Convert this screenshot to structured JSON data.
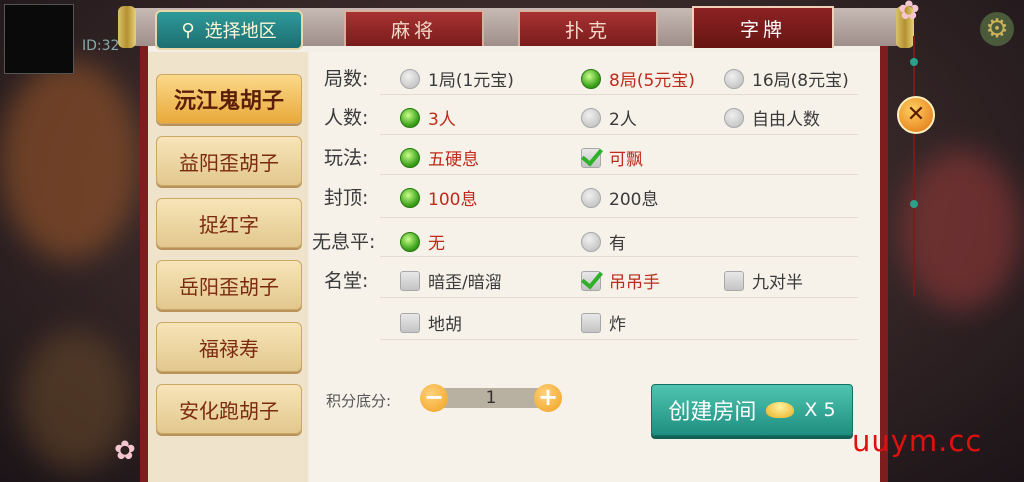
{
  "header": {
    "id_label": "ID:32",
    "region_button": "选择地区",
    "tabs": [
      {
        "label": "麻将"
      },
      {
        "label": "扑克"
      },
      {
        "label": "字牌"
      }
    ]
  },
  "sidebar": {
    "items": [
      {
        "label": "沅江鬼胡子"
      },
      {
        "label": "益阳歪胡子"
      },
      {
        "label": "捉红字"
      },
      {
        "label": "岳阳歪胡子"
      },
      {
        "label": "福禄寿"
      },
      {
        "label": "安化跑胡子"
      }
    ]
  },
  "rules": {
    "rounds": {
      "label": "局数:",
      "options": [
        {
          "text": "1局(1元宝)",
          "selected": false
        },
        {
          "text": "8局(5元宝)",
          "selected": true
        },
        {
          "text": "16局(8元宝)",
          "selected": false
        }
      ]
    },
    "players": {
      "label": "人数:",
      "options": [
        {
          "text": "3人",
          "selected": true
        },
        {
          "text": "2人",
          "selected": false
        },
        {
          "text": "自由人数",
          "selected": false
        }
      ]
    },
    "play": {
      "label": "玩法:",
      "options": [
        {
          "text": "五硬息",
          "selected": true
        },
        {
          "text": "可飘",
          "selected": true
        }
      ]
    },
    "cap": {
      "label": "封顶:",
      "options": [
        {
          "text": "100息",
          "selected": true
        },
        {
          "text": "200息",
          "selected": false
        }
      ]
    },
    "no_xi": {
      "label": "无息平:",
      "options": [
        {
          "text": "无",
          "selected": true
        },
        {
          "text": "有",
          "selected": false
        }
      ]
    },
    "mingtang": {
      "label": "名堂:",
      "options": [
        {
          "text": "暗歪/暗溜",
          "selected": false
        },
        {
          "text": "吊吊手",
          "selected": true
        },
        {
          "text": "九对半",
          "selected": false
        },
        {
          "text": "地胡",
          "selected": false
        },
        {
          "text": "炸",
          "selected": false
        }
      ]
    }
  },
  "score": {
    "label": "积分底分:",
    "value": "1",
    "minus": "−",
    "plus": "+"
  },
  "create": {
    "label": "创建房间",
    "cost": "X 5"
  },
  "close_symbol": "✕",
  "watermark": "uuym.cc",
  "colors": {
    "selected_text": "#c02a1a",
    "tab_red": "#7a1c1c",
    "create_teal": "#1f8e80"
  }
}
